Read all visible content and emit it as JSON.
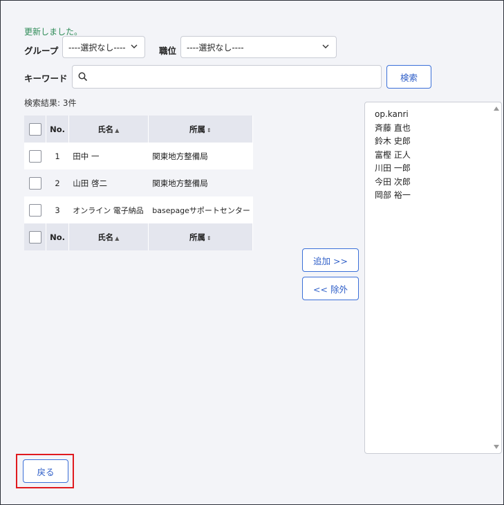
{
  "message": "更新しました。",
  "filters": {
    "group_label": "グループ",
    "group_value": "----選択なし----",
    "position_label": "職位",
    "position_value": "----選択なし----",
    "keyword_label": "キーワード",
    "keyword_value": "",
    "keyword_placeholder": "",
    "search_button": "検索"
  },
  "results": {
    "count_text": "検索結果: 3件",
    "columns": {
      "no": "No.",
      "name": "氏名",
      "dept": "所属"
    },
    "rows": [
      {
        "no": "1",
        "name": "田中 一",
        "dept": "関東地方整備局"
      },
      {
        "no": "2",
        "name": "山田 啓二",
        "dept": "関東地方整備局"
      },
      {
        "no": "3",
        "name": "オンライン 電子納品",
        "dept": "basepageサポートセンター"
      }
    ]
  },
  "transfer": {
    "add_button": "追加 >>",
    "remove_button": "<< 除外"
  },
  "selected_users": [
    "op.kanri",
    "斉藤 直也",
    "鈴木 史郎",
    "富樫 正人",
    "川田 一郎",
    "今田 次郎",
    "岡部 裕一"
  ],
  "back_button": "戻る",
  "icons": {
    "search": "search-icon",
    "chevron": "chevron-down-icon",
    "sort_asc": "▲",
    "sort_both": "⇕"
  },
  "colors": {
    "accent": "#3a6fd8",
    "success": "#2e8b57",
    "highlight": "#e0191e"
  }
}
